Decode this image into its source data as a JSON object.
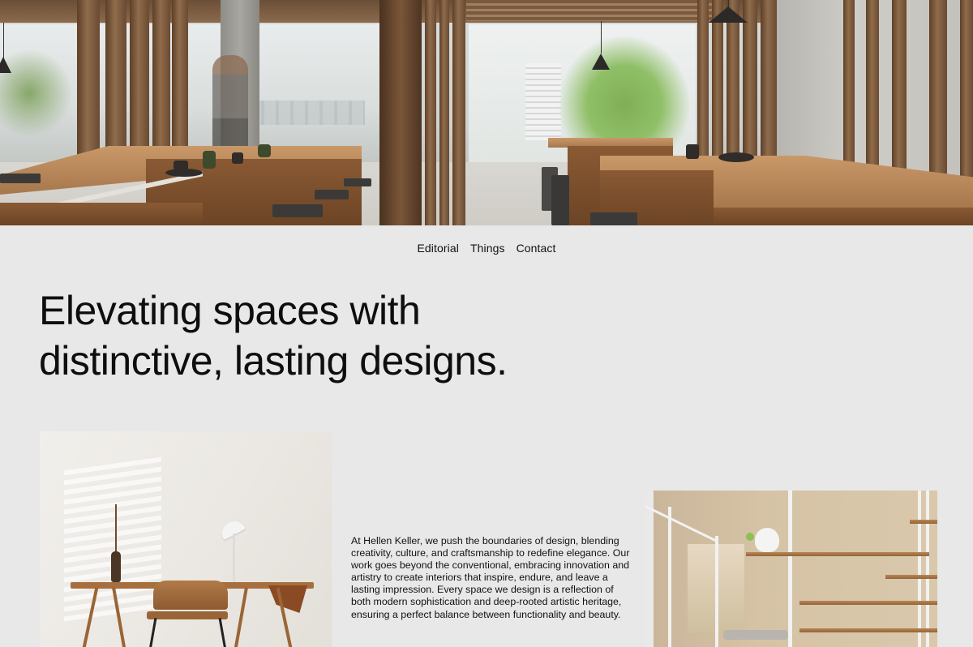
{
  "hero": {
    "alt": ""
  },
  "nav": {
    "items": [
      {
        "label": "Editorial"
      },
      {
        "label": "Things"
      },
      {
        "label": "Contact"
      }
    ]
  },
  "headline": {
    "line1": "Elevating spaces with",
    "line2": "distinctive, lasting designs."
  },
  "about": {
    "text": "At Hellen Keller, we push the boundaries of design, blending creativity, culture, and craftsmanship to redefine elegance. Our work goes beyond the conventional, embracing innovation and artistry to create interiors that inspire, endure, and leave a lasting impression. Every space we design is a reflection of both modern sophistication and deep-rooted artistic heritage, ensuring a perfect balance between functionality and beauty."
  },
  "colors": {
    "page_background": "#e8e8e8",
    "text": "#111111",
    "wood": "#a86f3e"
  }
}
